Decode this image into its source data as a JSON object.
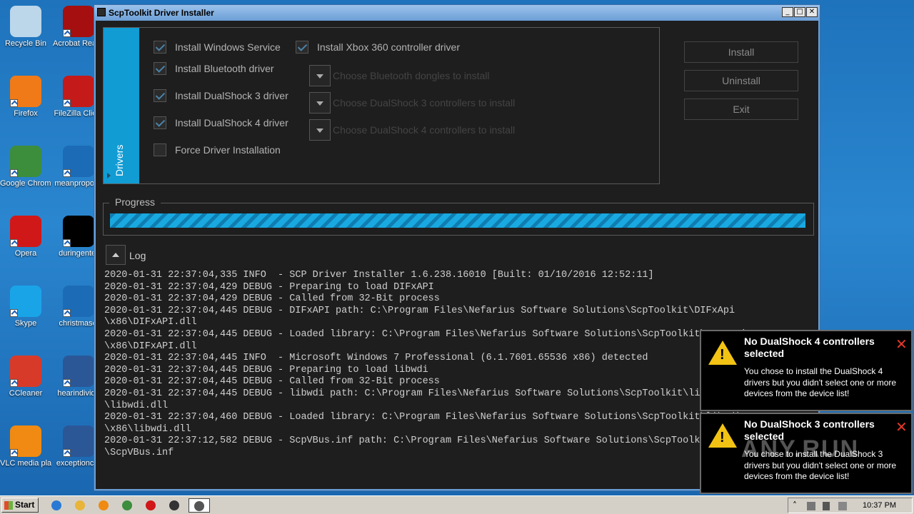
{
  "desktop": {
    "icons": [
      {
        "label": "Recycle Bin",
        "color": "#bcd6ea"
      },
      {
        "label": "Acrobat Reader DC",
        "color": "#a50f0f"
      },
      {
        "label": "Firefox",
        "color": "#f07a18"
      },
      {
        "label": "FileZilla Client",
        "color": "#c41a1a"
      },
      {
        "label": "Google Chrome",
        "color": "#3c8d3c"
      },
      {
        "label": "meanpropose",
        "color": "#1c6bb6"
      },
      {
        "label": "Opera",
        "color": "#d01818"
      },
      {
        "label": "duringenter",
        "color": "#000000"
      },
      {
        "label": "Skype",
        "color": "#1aa4e8"
      },
      {
        "label": "christmascl",
        "color": "#1c6bb6"
      },
      {
        "label": "CCleaner",
        "color": "#d83a2a"
      },
      {
        "label": "hearindividu",
        "color": "#2b5797"
      },
      {
        "label": "VLC media player",
        "color": "#f08a12"
      },
      {
        "label": "exceptioncer",
        "color": "#2b5797"
      }
    ]
  },
  "window": {
    "title": "ScpToolkit Driver Installer",
    "min_glyph": "_",
    "max_glyph": "□",
    "close_glyph": "✕"
  },
  "drivers": {
    "tab_label": "Drivers",
    "checkboxes": [
      {
        "label": "Install Windows Service",
        "checked": true
      },
      {
        "label": "Install Bluetooth driver",
        "checked": true
      },
      {
        "label": "Install DualShock 3 driver",
        "checked": true
      },
      {
        "label": "Install DualShock 4 driver",
        "checked": true
      },
      {
        "label": "Force Driver Installation",
        "checked": false
      },
      {
        "label": "Install Xbox 360 controller driver",
        "checked": true
      }
    ],
    "dropdowns": [
      {
        "label": "Choose Bluetooth dongles to install"
      },
      {
        "label": "Choose DualShock 3 controllers to install"
      },
      {
        "label": "Choose DualShock 4 controllers to install"
      }
    ]
  },
  "actions": {
    "install": "Install",
    "uninstall": "Uninstall",
    "exit": "Exit"
  },
  "progress": {
    "label": "Progress",
    "state": "indeterminate"
  },
  "log": {
    "label": "Log",
    "lines": [
      "2020-01-31 22:37:04,335 INFO  - SCP Driver Installer 1.6.238.16010 [Built: 01/10/2016 12:52:11]",
      "2020-01-31 22:37:04,429 DEBUG - Preparing to load DIFxAPI",
      "2020-01-31 22:37:04,429 DEBUG - Called from 32-Bit process",
      "2020-01-31 22:37:04,445 DEBUG - DIFxAPI path: C:\\Program Files\\Nefarius Software Solutions\\ScpToolkit\\DIFxApi",
      "\\x86\\DIFxAPI.dll",
      "2020-01-31 22:37:04,445 DEBUG - Loaded library: C:\\Program Files\\Nefarius Software Solutions\\ScpToolkit\\DIFxApi",
      "\\x86\\DIFxAPI.dll",
      "2020-01-31 22:37:04,445 INFO  - Microsoft Windows 7 Professional (6.1.7601.65536 x86) detected",
      "2020-01-31 22:37:04,445 DEBUG - Preparing to load libwdi",
      "2020-01-31 22:37:04,445 DEBUG - Called from 32-Bit process",
      "2020-01-31 22:37:04,445 DEBUG - libwdi path: C:\\Program Files\\Nefarius Software Solutions\\ScpToolkit\\libwdi",
      "\\libwdi.dll",
      "2020-01-31 22:37:04,460 DEBUG - Loaded library: C:\\Program Files\\Nefarius Software Solutions\\ScpToolkit\\libwdi",
      "\\x86\\libwdi.dll",
      "2020-01-31 22:37:12,582 DEBUG - ScpVBus.inf path: C:\\Program Files\\Nefarius Software Solutions\\ScpToolkit",
      "\\ScpVBus.inf"
    ]
  },
  "toasts": [
    {
      "title": "No DualShock 4 controllers selected",
      "body": "You chose to install the DualShock 4 drivers but you didn't select one or more devices from the device list!",
      "warn_glyph": "!",
      "close_glyph": "✕"
    },
    {
      "title": "No DualShock 3 controllers selected",
      "body": "You chose to install the DualShock 3 drivers but you didn't select one or more devices from the device list!",
      "warn_glyph": "!",
      "close_glyph": "✕"
    }
  ],
  "taskbar": {
    "start": "Start",
    "apps": [
      {
        "icon": "ie-icon",
        "color": "#2a7ad4"
      },
      {
        "icon": "explorer-icon",
        "color": "#e8b53a"
      },
      {
        "icon": "media-player-icon",
        "color": "#f08a12"
      },
      {
        "icon": "chrome-icon",
        "color": "#3c8d3c"
      },
      {
        "icon": "opera-icon",
        "color": "#d01818"
      },
      {
        "icon": "scptoolkit-icon",
        "color": "#333333"
      },
      {
        "icon": "installer-icon",
        "color": "#555555"
      }
    ],
    "tray": {
      "expand_glyph": "˄",
      "clock": "10:37 PM"
    }
  },
  "watermark": "ANY.RUN"
}
